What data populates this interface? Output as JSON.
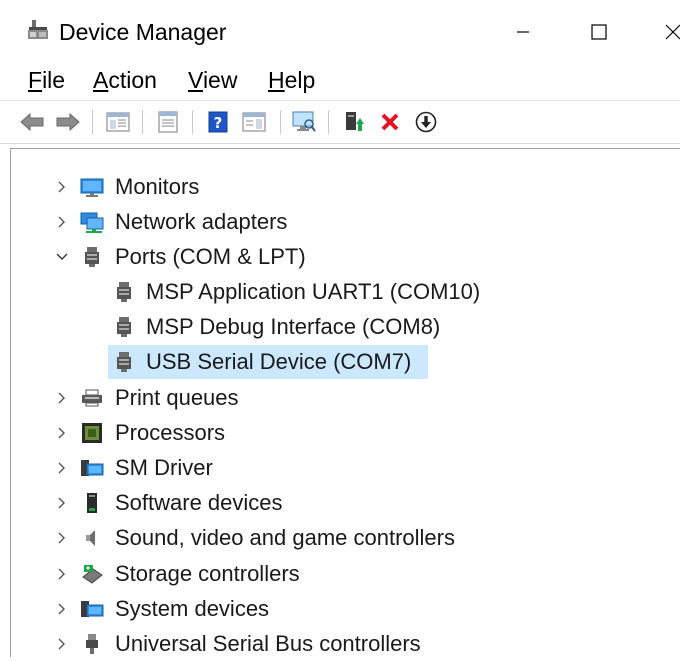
{
  "window": {
    "title": "Device Manager"
  },
  "menu": [
    {
      "ul": "F",
      "rest": "ile"
    },
    {
      "ul": "A",
      "rest": "ction"
    },
    {
      "ul": "V",
      "rest": "iew"
    },
    {
      "ul": "H",
      "rest": "elp"
    }
  ],
  "toolbar": {
    "buttons": [
      "back-icon",
      "forward-icon",
      "show-hide-console-tree-icon",
      "properties-sheet-icon",
      "help-icon",
      "action-pane-icon",
      "scan-hardware-icon",
      "update-driver-icon",
      "uninstall-device-icon",
      "enable-device-icon"
    ]
  },
  "tree": {
    "categories_top": [
      {
        "label": "Monitors",
        "icon": "monitor-icon"
      },
      {
        "label": "Network adapters",
        "icon": "network-adapter-icon"
      },
      {
        "label": "Ports (COM & LPT)",
        "icon": "port-icon",
        "expanded": true
      }
    ],
    "ports_children": [
      {
        "label": "MSP Application UART1 (COM10)",
        "icon": "port-icon"
      },
      {
        "label": "MSP Debug Interface (COM8)",
        "icon": "port-icon"
      },
      {
        "label": "USB Serial Device (COM7)",
        "icon": "port-icon",
        "selected": true
      }
    ],
    "categories_bottom": [
      {
        "label": "Print queues",
        "icon": "printer-icon"
      },
      {
        "label": "Processors",
        "icon": "processor-icon"
      },
      {
        "label": "SM Driver",
        "icon": "sm-driver-icon"
      },
      {
        "label": "Software devices",
        "icon": "software-device-icon"
      },
      {
        "label": "Sound, video and game controllers",
        "icon": "speaker-icon"
      },
      {
        "label": "Storage controllers",
        "icon": "storage-controller-icon"
      },
      {
        "label": "System devices",
        "icon": "system-devices-icon"
      },
      {
        "label": "Universal Serial Bus controllers",
        "icon": "usb-icon"
      }
    ]
  },
  "colors": {
    "selection": "#cce8ff",
    "help_blue": "#1e56c9",
    "delete_red": "#e81123"
  }
}
